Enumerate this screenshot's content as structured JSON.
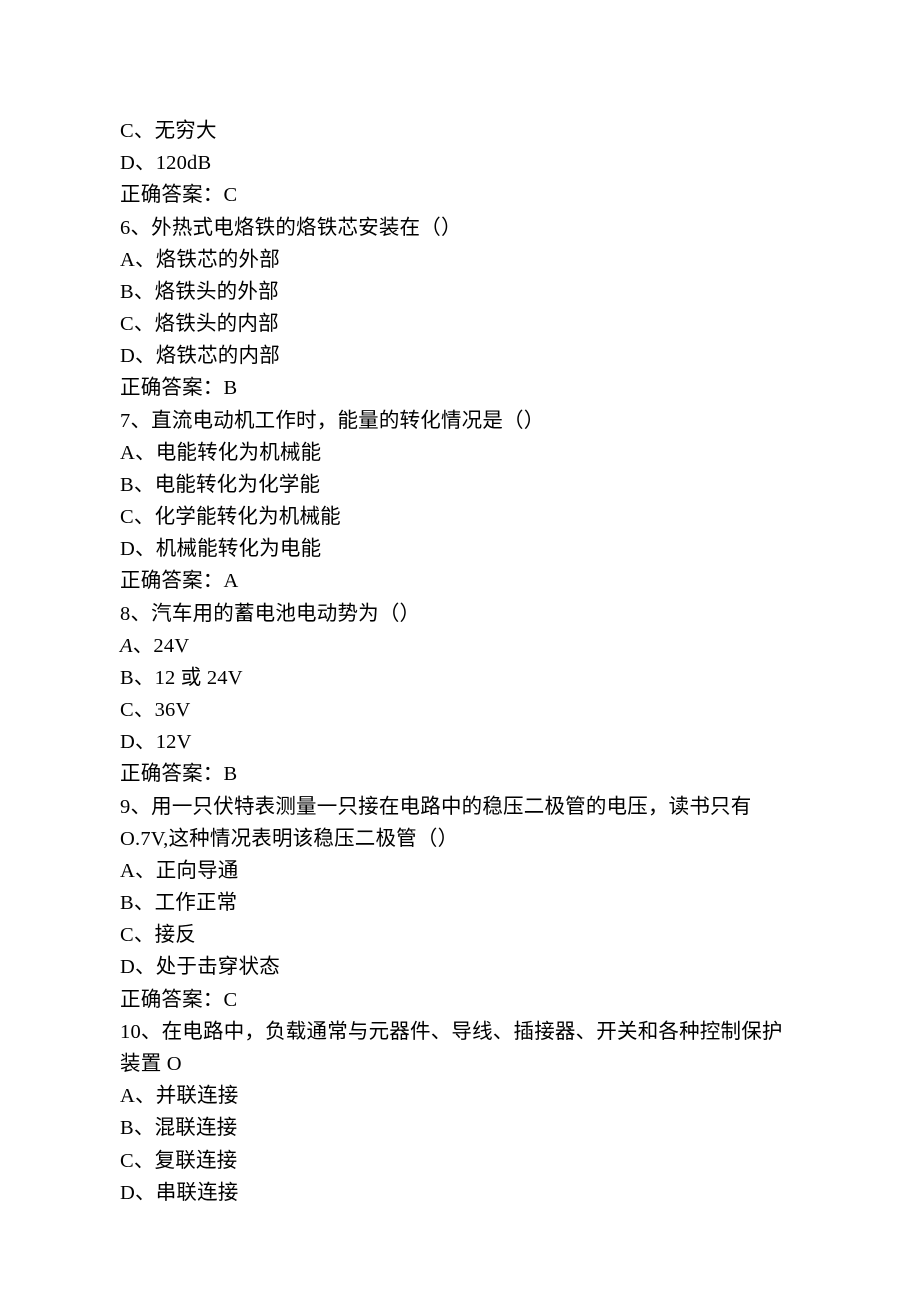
{
  "q5": {
    "optC": "C、无穷大",
    "optD": "D、120dB",
    "ans": "正确答案：C"
  },
  "q6": {
    "stem": "6、外热式电烙铁的烙铁芯安装在（）",
    "optA": "A、烙铁芯的外部",
    "optB": "B、烙铁头的外部",
    "optC": "C、烙铁头的内部",
    "optD": "D、烙铁芯的内部",
    "ans": "正确答案：B"
  },
  "q7": {
    "stem": "7、直流电动机工作时，能量的转化情况是（）",
    "optA": "A、电能转化为机械能",
    "optB": "B、电能转化为化学能",
    "optC": "C、化学能转化为机械能",
    "optD": "D、机械能转化为电能",
    "ans": "正确答案：A"
  },
  "q8": {
    "stem": "8、汽车用的蓄电池电动势为（）",
    "optA_letter": "A",
    "optA_rest": "、24V",
    "optB": "B、12 或 24V",
    "optC": "C、36V",
    "optD": "D、12V",
    "ans": "正确答案：B"
  },
  "q9": {
    "stem1": "9、用一只伏特表测量一只接在电路中的稳压二极管的电压，读书只有",
    "stem2": "O.7V,这种情况表明该稳压二极管（）",
    "optA": "A、正向导通",
    "optB": "B、工作正常",
    "optC": "C、接反",
    "optD": "D、处于击穿状态",
    "ans": "正确答案：C"
  },
  "q10": {
    "stem1": "10、在电路中，负载通常与元器件、导线、插接器、开关和各种控制保护",
    "stem2": "装置 O",
    "optA": "A、并联连接",
    "optB": "B、混联连接",
    "optC": "C、复联连接",
    "optD": "D、串联连接"
  }
}
